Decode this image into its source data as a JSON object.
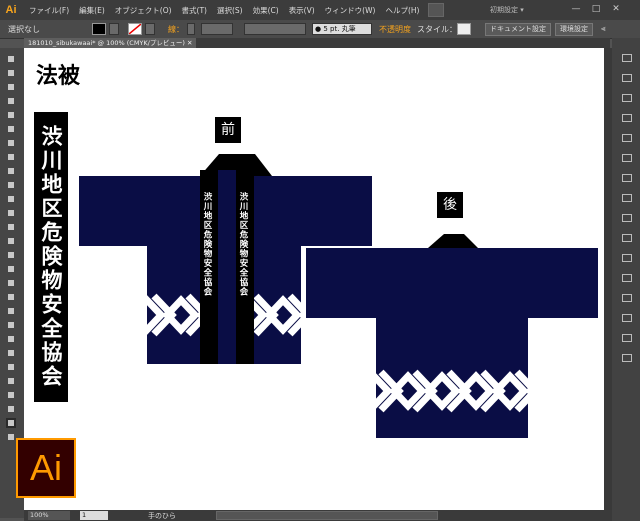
{
  "menubar": {
    "app_logo": "Ai",
    "items": [
      "ファイル(F)",
      "編集(E)",
      "オブジェクト(O)",
      "書式(T)",
      "選択(S)",
      "効果(C)",
      "表示(V)",
      "ウィンドウ(W)",
      "ヘルプ(H)"
    ],
    "workspace": "初期設定"
  },
  "control": {
    "selection": "選択なし",
    "stroke_label": "線：",
    "brush": "5 pt. 丸筆",
    "opacity": "不透明度",
    "style": "スタイル：",
    "doc_setup": "ドキュメント設定",
    "prefs": "環境設定"
  },
  "document": {
    "tab": "181010_sibukawaai* @ 100% (CMYK/プレビュー)"
  },
  "status": {
    "zoom": "100%",
    "page": "1",
    "tool": "手のひら"
  },
  "artboard": {
    "title": "法被",
    "vertical_label": "渋川地区危険物安全協会",
    "front_label": "前",
    "back_label": "後",
    "collar_text": "渋川地区危険物安全協会"
  },
  "colors": {
    "navy": "#0a0d45",
    "black": "#000000",
    "white": "#ffffff",
    "ai_orange": "#ff9a00"
  },
  "icons": {
    "tools": [
      "selection-tool",
      "direct-selection-tool",
      "magic-wand-tool",
      "lasso-tool",
      "pen-tool",
      "type-tool",
      "line-tool",
      "rectangle-tool",
      "paintbrush-tool",
      "pencil-tool",
      "blob-brush-tool",
      "eraser-tool",
      "rotate-tool",
      "scale-tool",
      "width-tool",
      "free-transform-tool",
      "shape-builder-tool",
      "perspective-grid-tool",
      "mesh-tool",
      "gradient-tool",
      "eyedropper-tool",
      "blend-tool",
      "symbol-sprayer-tool",
      "column-graph-tool",
      "artboard-tool",
      "slice-tool",
      "hand-tool",
      "zoom-tool"
    ],
    "panels": [
      "color-panel",
      "color-guide-panel",
      "swatches-panel",
      "brushes-panel",
      "symbols-panel",
      "graphic-styles-panel",
      "appearance-panel",
      "stroke-panel",
      "gradient-panel",
      "transparency-panel",
      "align-panel",
      "pathfinder-panel",
      "layers-panel",
      "artboards-panel",
      "links-panel",
      "info-panel"
    ]
  }
}
